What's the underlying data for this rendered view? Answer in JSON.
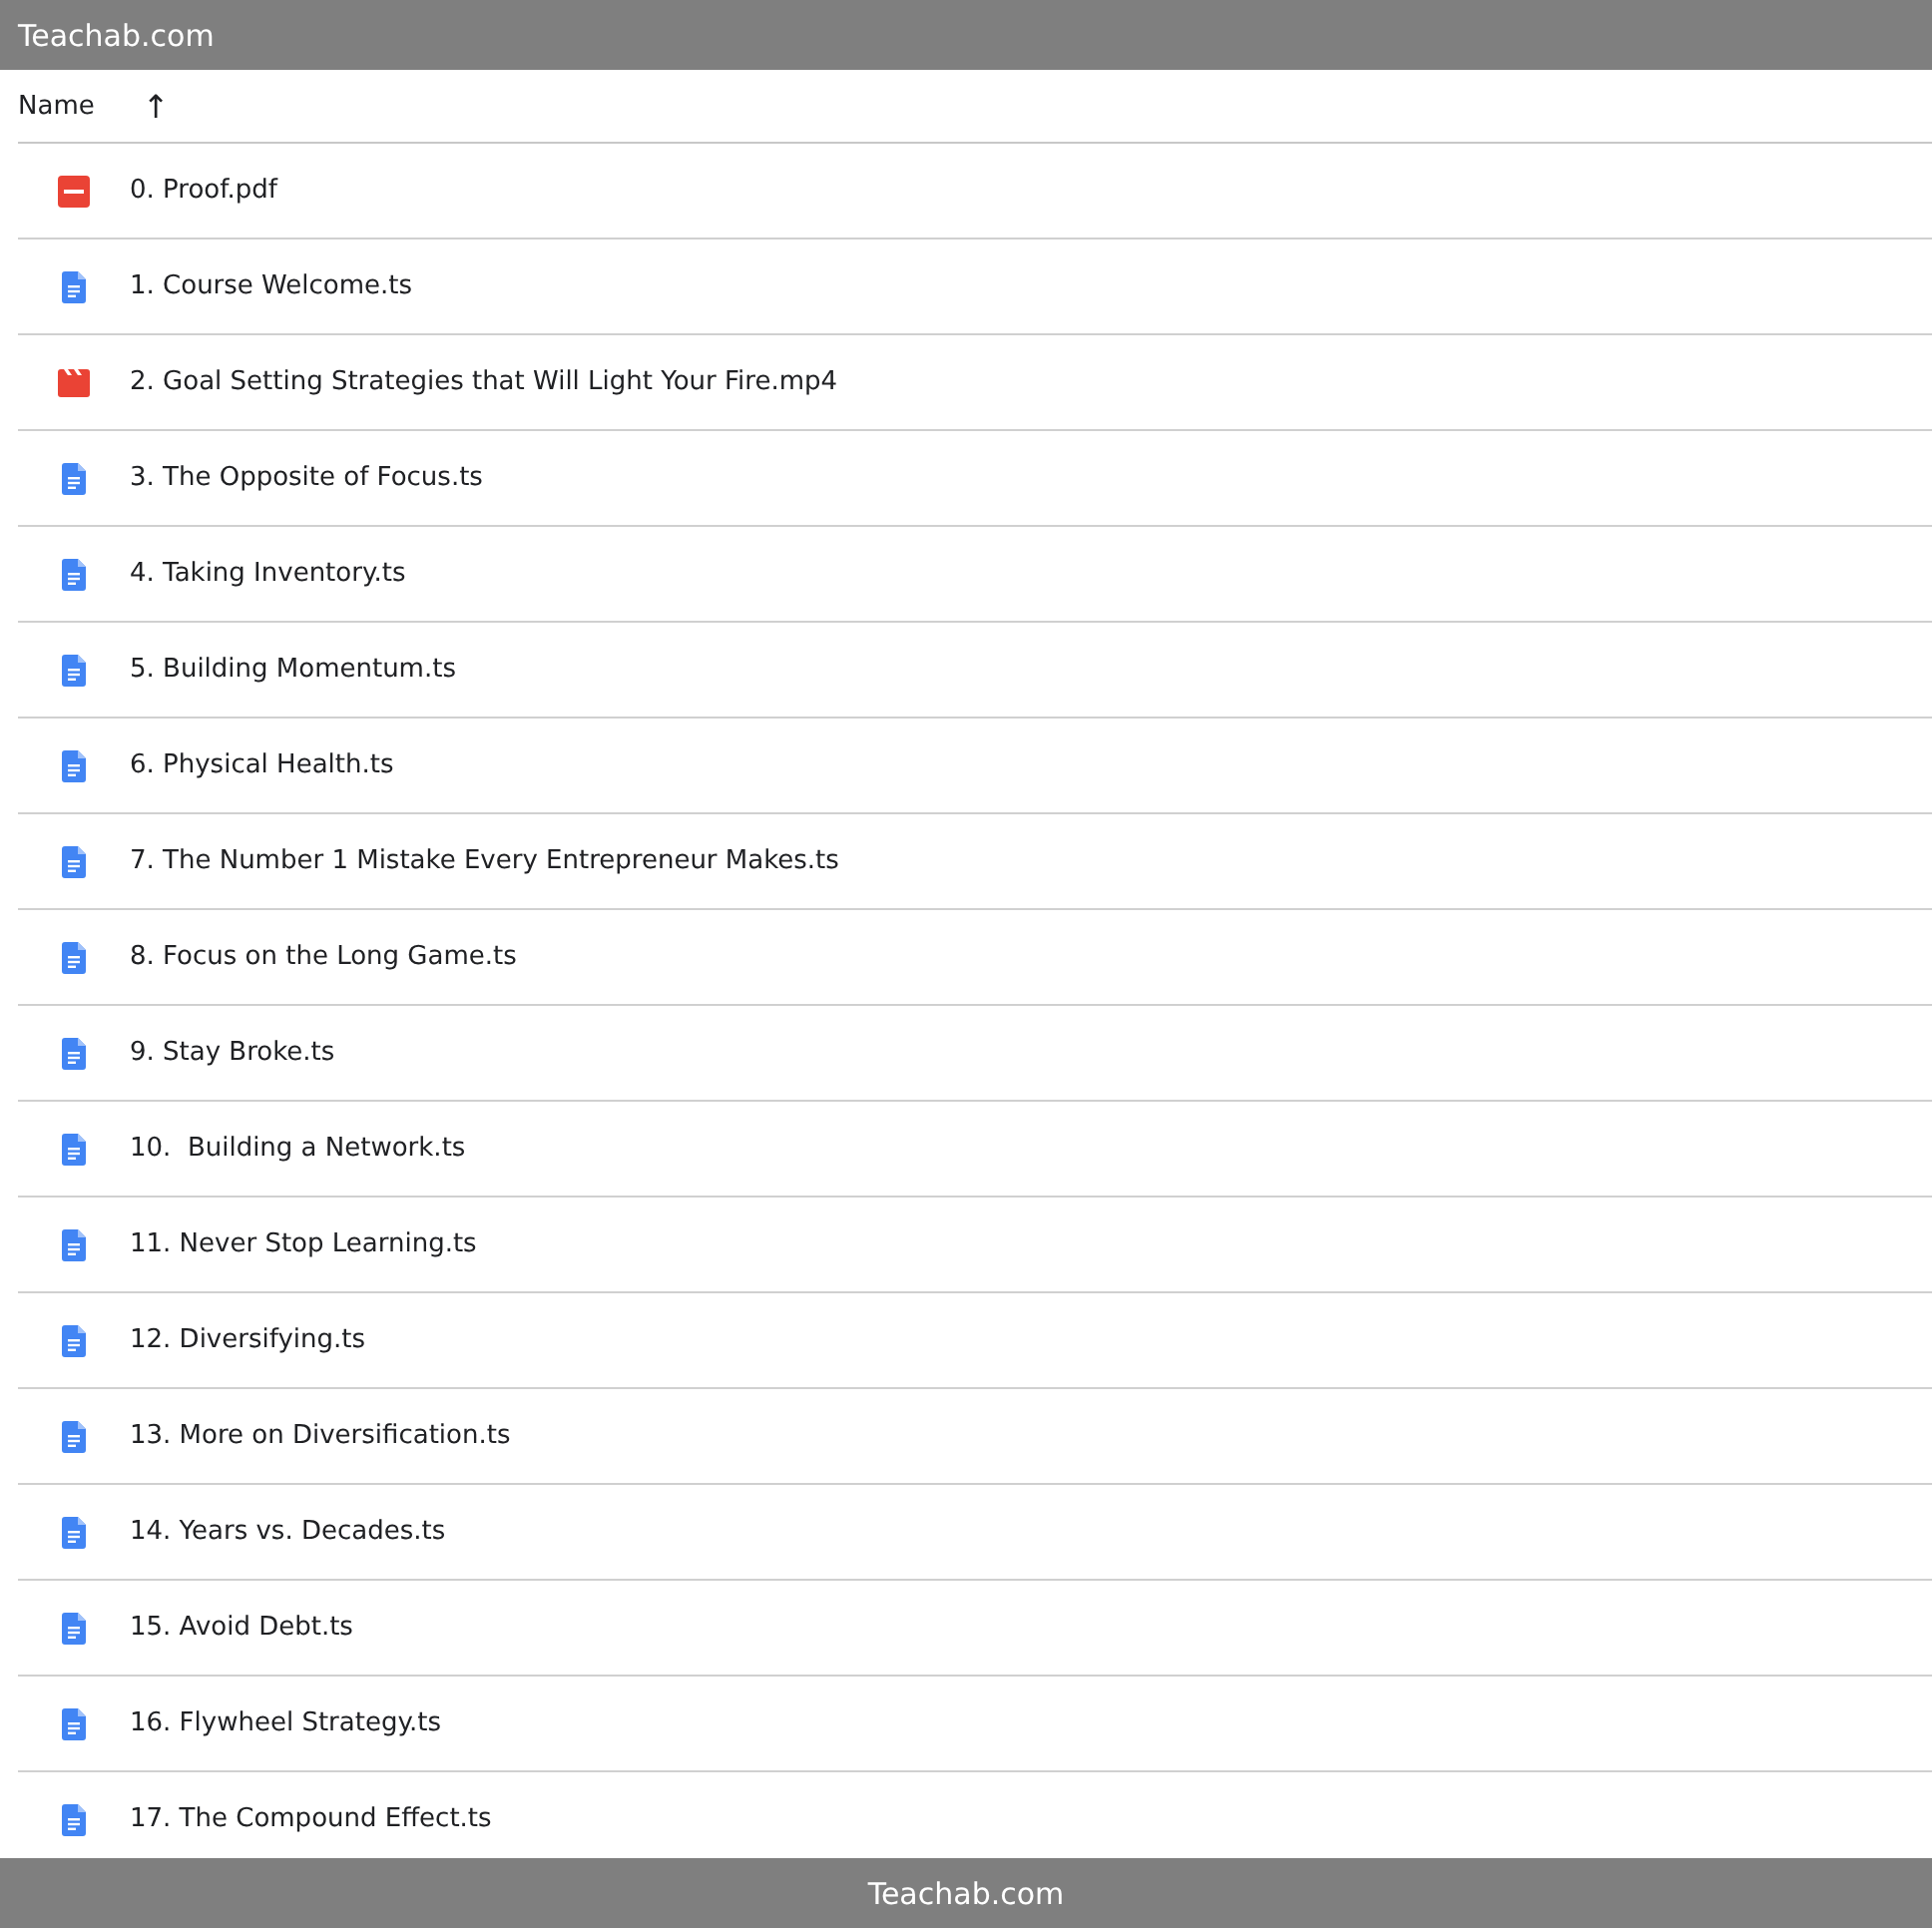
{
  "top_bar": {
    "title": "Teachab.com"
  },
  "column_header": {
    "label": "Name",
    "sort_icon": "↑"
  },
  "files": [
    {
      "name": "0. Proof.pdf",
      "kind": "pdf"
    },
    {
      "name": "1. Course Welcome.ts",
      "kind": "doc"
    },
    {
      "name": "2. Goal Setting Strategies that Will Light Your Fire.mp4",
      "kind": "video"
    },
    {
      "name": "3. The Opposite of Focus.ts",
      "kind": "doc"
    },
    {
      "name": "4. Taking Inventory.ts",
      "kind": "doc"
    },
    {
      "name": "5. Building Momentum.ts",
      "kind": "doc"
    },
    {
      "name": "6. Physical Health.ts",
      "kind": "doc"
    },
    {
      "name": "7. The Number 1 Mistake Every Entrepreneur Makes.ts",
      "kind": "doc"
    },
    {
      "name": "8. Focus on the Long Game.ts",
      "kind": "doc"
    },
    {
      "name": "9. Stay Broke.ts",
      "kind": "doc"
    },
    {
      "name": "10.  Building a Network.ts",
      "kind": "doc"
    },
    {
      "name": "11. Never Stop Learning.ts",
      "kind": "doc"
    },
    {
      "name": "12. Diversifying.ts",
      "kind": "doc"
    },
    {
      "name": "13. More on Diversification.ts",
      "kind": "doc"
    },
    {
      "name": "14. Years vs. Decades.ts",
      "kind": "doc"
    },
    {
      "name": "15. Avoid Debt.ts",
      "kind": "doc"
    },
    {
      "name": "16. Flywheel Strategy.ts",
      "kind": "doc"
    },
    {
      "name": "17. The Compound Effect.ts",
      "kind": "doc"
    }
  ],
  "bottom_bar": {
    "title": "Teachab.com"
  }
}
